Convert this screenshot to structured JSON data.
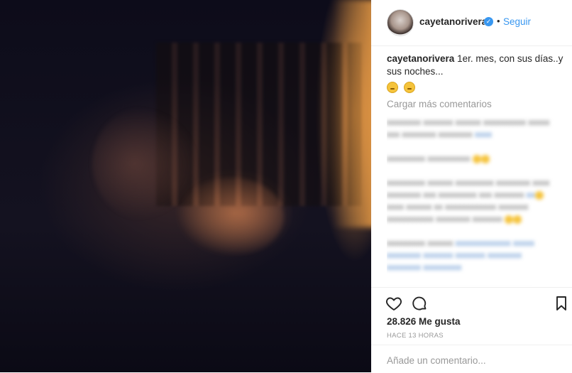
{
  "post": {
    "username": "cayetanorivera",
    "follow_label": "Seguir",
    "separator": "•",
    "verified_glyph": "✓",
    "caption_text": "1er. mes, con sus días..y sus noches...",
    "caption_emojis": [
      "weary-face-emoji",
      "grinning-sweat-emoji"
    ],
    "load_more_label": "Cargar más comentarios",
    "likes": "28.826 Me gusta",
    "timestamp": "HACE 13 HORAS",
    "comment_placeholder": "Añade un comentario..."
  },
  "icons": {
    "like": "heart-icon",
    "comment": "comment-icon",
    "save": "bookmark-icon",
    "verified": "verified-badge-icon"
  },
  "colors": {
    "link": "#3897f0",
    "text": "#262626",
    "muted": "#999999",
    "border": "#efefef"
  }
}
